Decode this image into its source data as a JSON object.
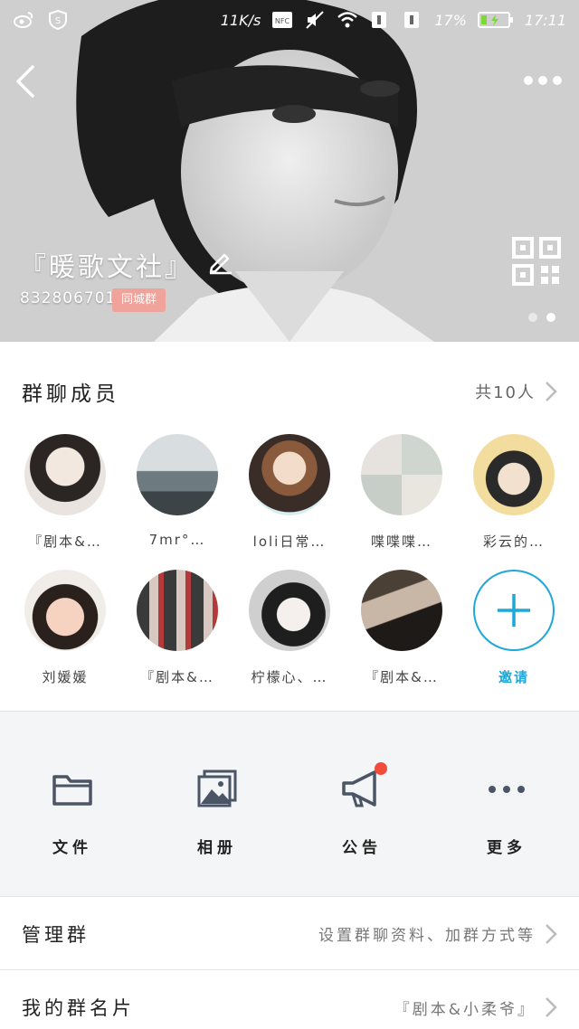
{
  "status_bar": {
    "speed": "11K/s",
    "battery": "17%",
    "time": "17:11"
  },
  "header": {
    "title": "『暖歌文社』",
    "group_id": "832806701",
    "badge": "同城群"
  },
  "members": {
    "title": "群聊成员",
    "count": "共10人",
    "items": [
      {
        "name": "『剧本&…"
      },
      {
        "name": "7mr°…"
      },
      {
        "name": "loli日常…"
      },
      {
        "name": "喋喋喋…"
      },
      {
        "name": "彩云的…"
      },
      {
        "name": "刘媛媛"
      },
      {
        "name": "『剧本&…"
      },
      {
        "name": "柠檬心、…"
      },
      {
        "name": "『剧本&…"
      }
    ],
    "invite_label": "邀请"
  },
  "tools": {
    "files": "文件",
    "album": "相册",
    "notice": "公告",
    "more": "更多"
  },
  "rows": {
    "manage_label": "管理群",
    "manage_value": "设置群聊资料、加群方式等",
    "card_label": "我的群名片",
    "card_value": "『剧本&小柔爷』"
  },
  "colors": {
    "accent": "#1fa7d8",
    "badge": "#f0a39b",
    "notice_dot": "#f24b3c"
  }
}
